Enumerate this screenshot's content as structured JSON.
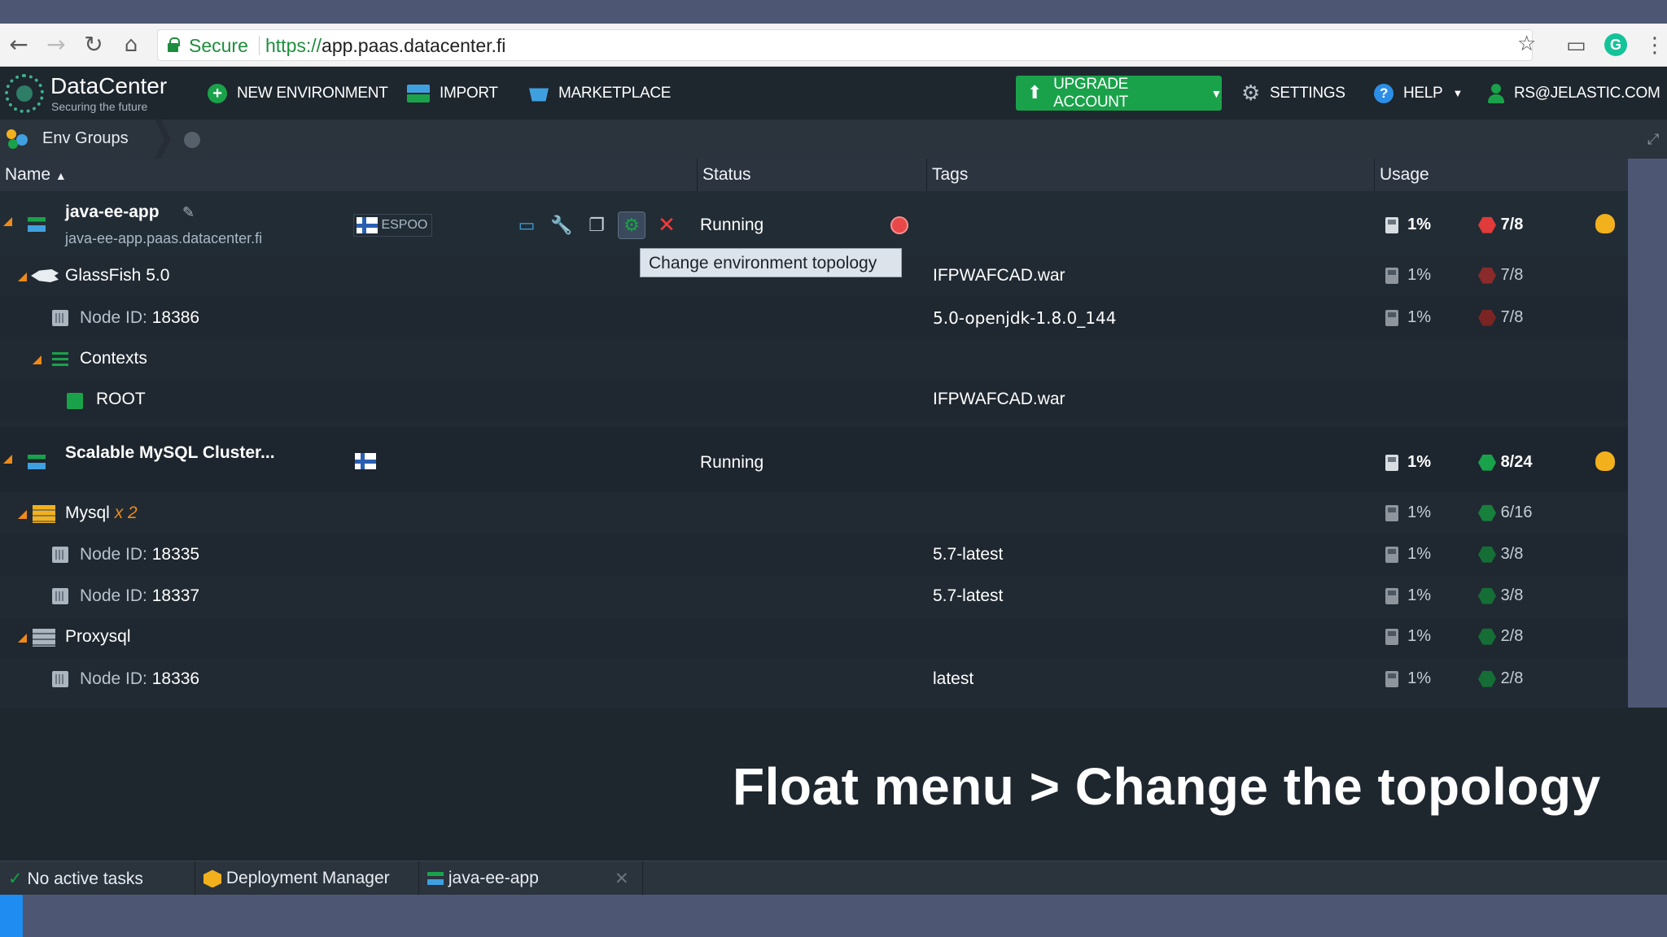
{
  "browser": {
    "secure_label": "Secure",
    "url_scheme": "https://",
    "url_rest": "app.paas.datacenter.fi",
    "icons": [
      "back-icon",
      "forward-icon",
      "reload-icon",
      "home-icon",
      "star-icon",
      "cast-icon",
      "grammarly-icon",
      "menu-icon"
    ]
  },
  "header": {
    "logo_title": "DataCenter",
    "logo_subtitle": "Securing the future",
    "new_env": "NEW ENVIRONMENT",
    "import": "IMPORT",
    "marketplace": "MARKETPLACE",
    "upgrade": "UPGRADE ACCOUNT",
    "settings": "SETTINGS",
    "help": "HELP",
    "user": "RS@JELASTIC.COM"
  },
  "env_groups": {
    "label": "Env Groups"
  },
  "columns": {
    "name": "Name",
    "status": "Status",
    "tags": "Tags",
    "usage": "Usage"
  },
  "env1": {
    "name": "java-ee-app",
    "domain": "java-ee-app.paas.datacenter.fi",
    "region": "ESPOO",
    "status": "Running",
    "disk": "1%",
    "cloudlets": "7/8",
    "tooltip": "Change environment topology",
    "glassfish": {
      "name": "GlassFish",
      "version": "5.0",
      "tag": "IFPWAFCAD.war",
      "disk": "1%",
      "cloudlets": "7/8"
    },
    "node": {
      "label": "Node ID:",
      "id": "18386",
      "tag": "5.0-openjdk-1.8.0_144",
      "disk": "1%",
      "cloudlets": "7/8"
    },
    "contexts": "Contexts",
    "root": {
      "name": "ROOT",
      "tag": "IFPWAFCAD.war"
    }
  },
  "env2": {
    "name": "Scalable MySQL Cluster...",
    "status": "Running",
    "disk": "1%",
    "cloudlets": "8/24",
    "mysql": {
      "name": "Mysql",
      "count": "x 2",
      "disk": "1%",
      "cloudlets": "6/16"
    },
    "mysql_nodes": [
      {
        "label": "Node ID:",
        "id": "18335",
        "tag": "5.7-latest",
        "disk": "1%",
        "cloudlets": "3/8"
      },
      {
        "label": "Node ID:",
        "id": "18337",
        "tag": "5.7-latest",
        "disk": "1%",
        "cloudlets": "3/8"
      }
    ],
    "proxysql": {
      "name": "Proxysql",
      "disk": "1%",
      "cloudlets": "2/8"
    },
    "proxy_node": {
      "label": "Node ID:",
      "id": "18336",
      "tag": "latest",
      "disk": "1%",
      "cloudlets": "2/8"
    }
  },
  "caption": "Float menu > Change the topology",
  "taskbar": {
    "tasks": "No active tasks",
    "deploy": "Deployment Manager",
    "env": "java-ee-app"
  },
  "colors": {
    "accent_green": "#1aa24a",
    "warning_red": "#e03a3a",
    "orange": "#f08a16"
  }
}
